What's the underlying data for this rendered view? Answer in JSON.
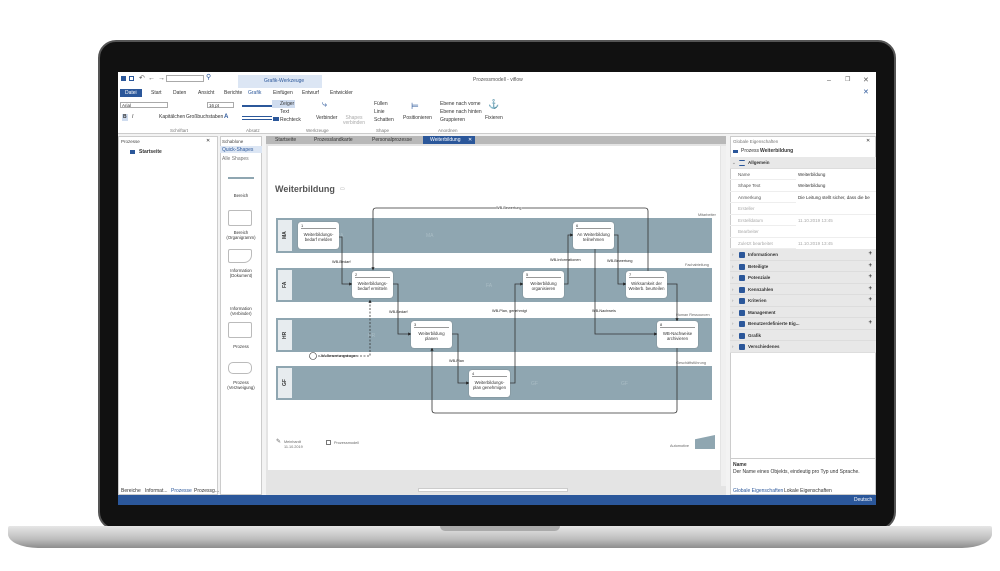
{
  "window": {
    "title": "Prozessmodell - viflow",
    "contextual_tab": "Grafik-Werkzeuge"
  },
  "ribbon": {
    "tabs": [
      "Datei",
      "Start",
      "Daten",
      "Ansicht",
      "Berichte",
      "Grafik",
      "Einfügen",
      "Entwurf",
      "Entwickler"
    ],
    "active_tab": "Grafik",
    "font_name": "Arial",
    "font_size": "16 pt",
    "font_buttons": [
      "B",
      "I",
      "Kapitälchen",
      "Großbuchstaben"
    ],
    "tools": {
      "pointer": "Zeiger",
      "text": "Text",
      "rect": "Rechteck",
      "connector": "Verbinder",
      "connect_shapes": "Shapes verbinden"
    },
    "shape": {
      "fill": "Füllen",
      "line": "Linie",
      "shadow": "Schatten"
    },
    "arrange": {
      "position": "Positionieren",
      "front": "Ebene nach vorne",
      "back": "Ebene nach hinten",
      "group": "Gruppieren",
      "fix": "Fixieren"
    },
    "groups": [
      "Schriftart",
      "Absatz",
      "Werkzeuge",
      "Shape",
      "Anordnen"
    ]
  },
  "left_panel": {
    "title": "Prozesse",
    "tree": [
      "Startseite"
    ],
    "tabs": [
      "Bereiche",
      "Informat...",
      "Prozesse",
      "Prozessg..."
    ],
    "active_tab": "Prozesse"
  },
  "stencil": {
    "title": "Schablone",
    "sections": [
      "Quick-Shapes",
      "Alle Shapes"
    ],
    "items": [
      "Bereich",
      "Bereich (Organigramm)",
      "Information (Dokument)",
      "Information (Verbinder)",
      "Prozess",
      "Prozess (Verzweigung)"
    ]
  },
  "doc_tabs": {
    "items": [
      "Startseite",
      "Prozesslandkarte",
      "Personalprozesse",
      "Weiterbildung"
    ],
    "active": "Weiterbildung"
  },
  "diagram": {
    "title": "Weiterbildung",
    "lanes": [
      {
        "code": "MA",
        "name": "Mitarbeiter"
      },
      {
        "code": "FA",
        "name": "Fachabteilung"
      },
      {
        "code": "HR",
        "name": "Human Ressourcen"
      },
      {
        "code": "GF",
        "name": "Geschäftsführung"
      }
    ],
    "processes": [
      {
        "num": "1",
        "label": "Weiterbildungs-bedarf melden"
      },
      {
        "num": "2",
        "label": "Weiterbildungs-bedarf ermitteln"
      },
      {
        "num": "3",
        "label": "Weiterbildung planen"
      },
      {
        "num": "4",
        "label": "Weiterbildungs-plan genehmigen"
      },
      {
        "num": "5",
        "label": "Weiterbildung organisieren"
      },
      {
        "num": "6",
        "label": "An Weiterbildung teilnehmen"
      },
      {
        "num": "7",
        "label": "Wirksamkeit der Weiterb. beurteilen"
      },
      {
        "num": "8",
        "label": "WB-Nachweise archivieren"
      }
    ],
    "connector_labels": [
      "WB-Bewertung",
      "WB-Bedarf",
      "WB-Bedarf",
      "WB-Plan, genehmigt",
      "WB-Informationen",
      "WB-Bewertung",
      "WB-Nachweis",
      "WB-Plan",
      "JIA-Bewertungsbogen"
    ],
    "footer": {
      "author": "Meinhardt",
      "date": "11.10.2019",
      "type": "Prozessmodell",
      "logo": "Automotive"
    }
  },
  "props": {
    "title": "Globale Eigenschaften",
    "object_type": "Prozess",
    "object_name": "Weiterbildung",
    "general": "Allgemein",
    "rows": [
      {
        "k": "Name",
        "v": "Weiterbildung"
      },
      {
        "k": "Shape Text",
        "v": "Weiterbildung"
      },
      {
        "k": "Anmerkung",
        "v": "Die Leitung stellt sicher, dass die be"
      },
      {
        "k": "Ersteller",
        "v": ""
      },
      {
        "k": "Erstelldatum",
        "v": "11.10.2019 13:45"
      },
      {
        "k": "Bearbeiter",
        "v": ""
      },
      {
        "k": "Zuletzt bearbeitet",
        "v": "11.10.2019 13:45"
      }
    ],
    "sections": [
      "Informationen",
      "Beteiligte",
      "Potenziale",
      "Kennzahlen",
      "Kriterien",
      "Management",
      "Benutzerdefinierte Eig...",
      "Grafik",
      "Verschiedenes"
    ],
    "help_title": "Name",
    "help_text": "Der Name eines Objekts, eindeutig pro Typ und Sprache.",
    "tabs": [
      "Globale Eigenschaften",
      "Lokale Eigenschaften"
    ]
  },
  "status": {
    "language": "Deutsch"
  },
  "colors": {
    "accent": "#2b579a",
    "lane": "#8fa6b1"
  }
}
